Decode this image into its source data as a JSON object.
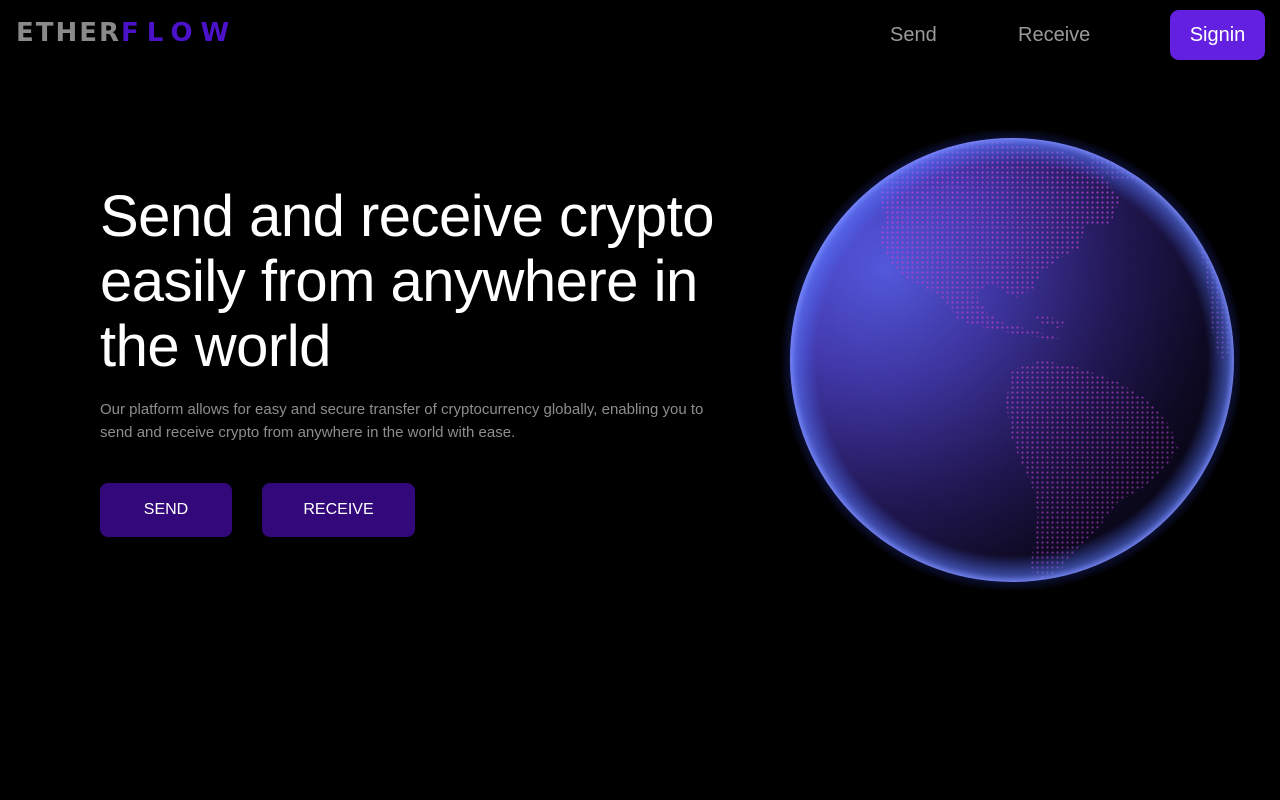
{
  "brand": {
    "logo_part_1": "ETHER",
    "logo_part_2": "FLOW",
    "logo_grey": "#8a8a8a",
    "logo_purple": "#4b12c9"
  },
  "nav": {
    "links": [
      {
        "label": "Send"
      },
      {
        "label": "Receive"
      }
    ],
    "signin_label": "Signin"
  },
  "hero": {
    "title": "Send and receive crypto easily from anywhere in the world",
    "subtitle": "Our platform allows for easy and secure transfer of cryptocurrency globally, enabling you to send and receive crypto from anywhere in the world with ease.",
    "send_button": "SEND",
    "receive_button": "RECEIVE"
  },
  "globe": {
    "icon": "globe-americas-illustration",
    "colors": {
      "ocean_light": "#5a5af0",
      "ocean_dark": "#120c2e",
      "land_dots": "#c044e8",
      "glow": "#4a6cff"
    }
  },
  "colors": {
    "background": "#000000",
    "accent": "#6320e0",
    "button": "#33087a",
    "text_primary": "#ffffff",
    "text_muted": "#8d8d8d"
  }
}
